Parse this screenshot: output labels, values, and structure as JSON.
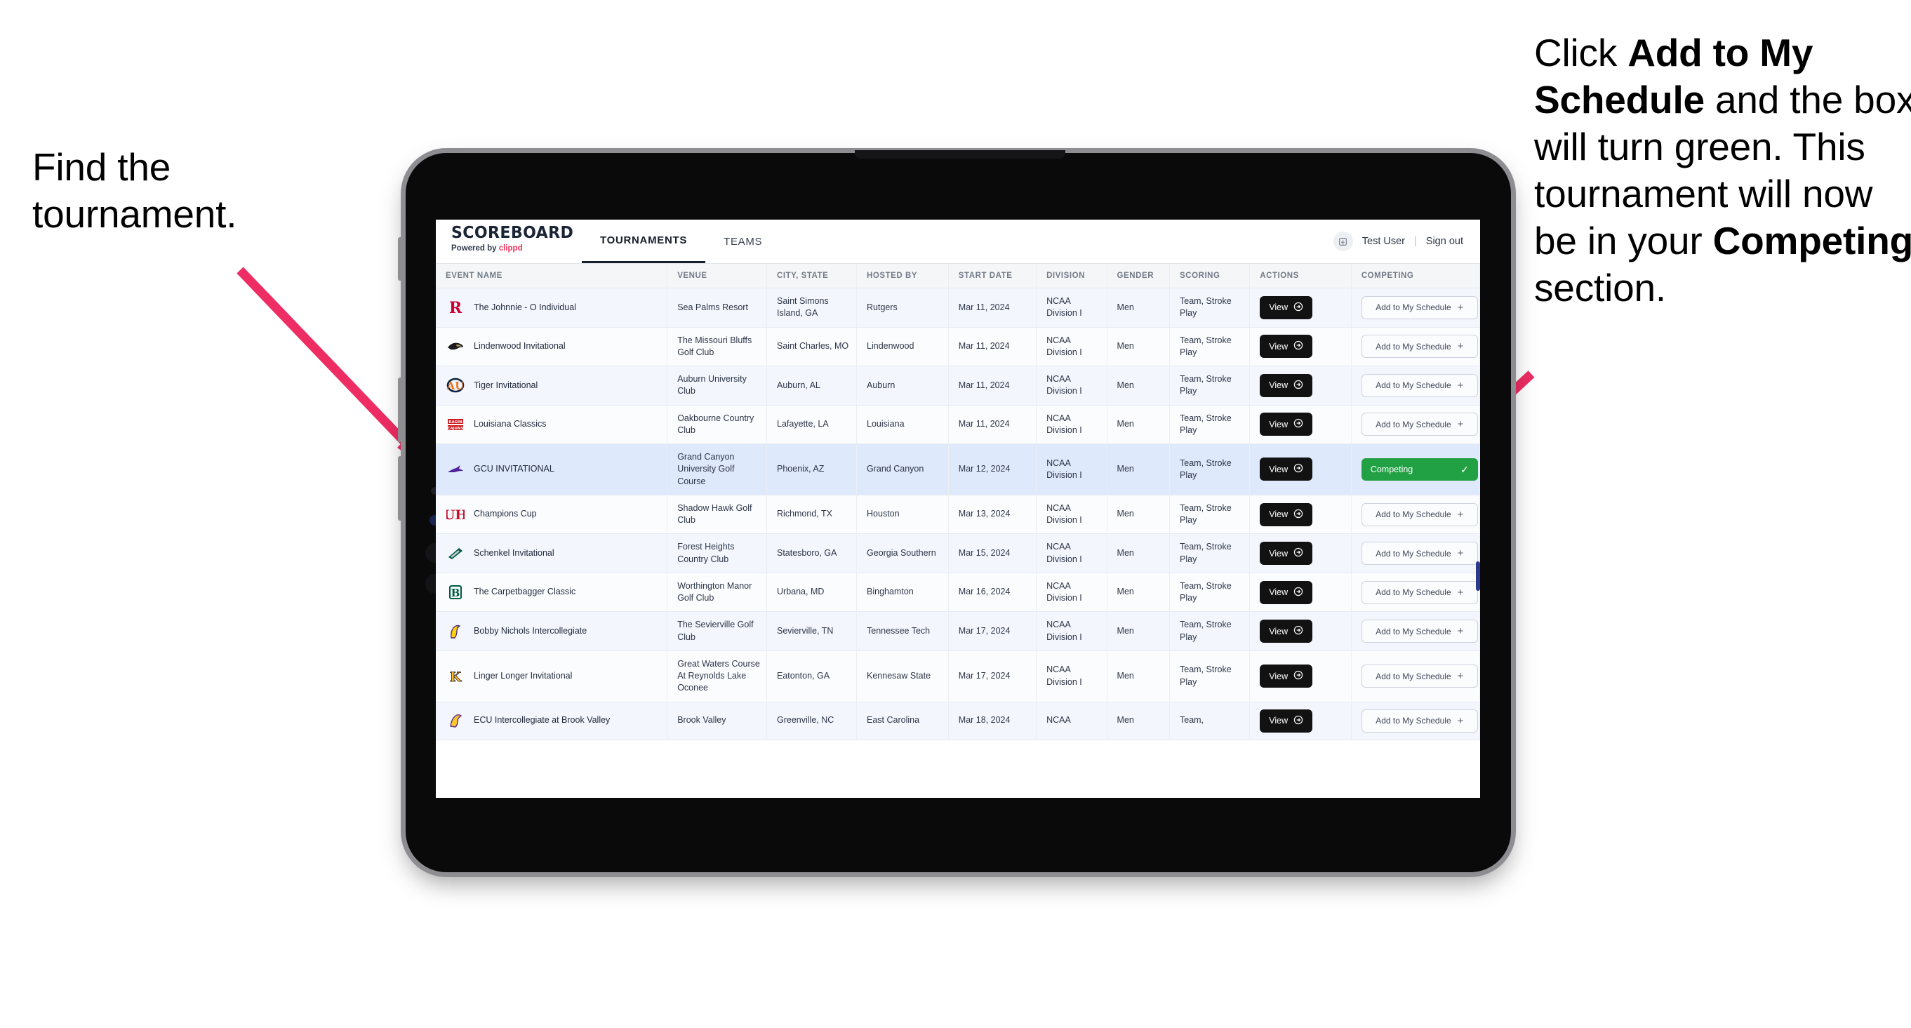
{
  "annotations": {
    "left": {
      "line1": "Find the",
      "line2": "tournament."
    },
    "right": {
      "seg1": "Click ",
      "bold1": "Add to My Schedule",
      "seg2": " and the box will turn green. This tournament will now be in your ",
      "bold2": "Competing",
      "seg3": " section."
    },
    "arrow_color": "#ED2D63"
  },
  "app": {
    "brand": {
      "title": "SCOREBOARD",
      "powered_prefix": "Powered by ",
      "powered_brand": "clippd"
    },
    "nav": [
      {
        "label": "TOURNAMENTS",
        "active": true
      },
      {
        "label": "TEAMS",
        "active": false
      }
    ],
    "account": {
      "avatar_icon": "user-avatar-icon",
      "user": "Test User",
      "separator": "|",
      "signout": "Sign out"
    },
    "table": {
      "columns": [
        "EVENT NAME",
        "VENUE",
        "CITY, STATE",
        "HOSTED BY",
        "START DATE",
        "DIVISION",
        "GENDER",
        "SCORING",
        "ACTIONS",
        "COMPETING"
      ],
      "view_label": "View",
      "add_label": "Add to My Schedule",
      "add_icon": "plus-icon",
      "competing_label": "Competing",
      "competing_icon": "check-icon",
      "view_icon": "arrow-circle-right-icon",
      "competing_color": "#22A144",
      "rows": [
        {
          "logo": "rutgers-logo",
          "event": "The Johnnie - O Individual",
          "venue": "Sea Palms Resort",
          "city": "Saint Simons Island, GA",
          "host": "Rutgers",
          "date": "Mar 11, 2024",
          "division": "NCAA Division I",
          "gender": "Men",
          "scoring": "Team, Stroke Play",
          "competing": false
        },
        {
          "logo": "lindenwood-logo",
          "event": "Lindenwood Invitational",
          "venue": "The Missouri Bluffs Golf Club",
          "city": "Saint Charles, MO",
          "host": "Lindenwood",
          "date": "Mar 11, 2024",
          "division": "NCAA Division I",
          "gender": "Men",
          "scoring": "Team, Stroke Play",
          "competing": false
        },
        {
          "logo": "auburn-logo",
          "event": "Tiger Invitational",
          "venue": "Auburn University Club",
          "city": "Auburn, AL",
          "host": "Auburn",
          "date": "Mar 11, 2024",
          "division": "NCAA Division I",
          "gender": "Men",
          "scoring": "Team, Stroke Play",
          "competing": false
        },
        {
          "logo": "louisiana-logo",
          "event": "Louisiana Classics",
          "venue": "Oakbourne Country Club",
          "city": "Lafayette, LA",
          "host": "Louisiana",
          "date": "Mar 11, 2024",
          "division": "NCAA Division I",
          "gender": "Men",
          "scoring": "Team, Stroke Play",
          "competing": false
        },
        {
          "logo": "gcu-logo",
          "event": "GCU INVITATIONAL",
          "venue": "Grand Canyon University Golf Course",
          "city": "Phoenix, AZ",
          "host": "Grand Canyon",
          "date": "Mar 12, 2024",
          "division": "NCAA Division I",
          "gender": "Men",
          "scoring": "Team, Stroke Play",
          "competing": true
        },
        {
          "logo": "houston-logo",
          "event": "Champions Cup",
          "venue": "Shadow Hawk Golf Club",
          "city": "Richmond, TX",
          "host": "Houston",
          "date": "Mar 13, 2024",
          "division": "NCAA Division I",
          "gender": "Men",
          "scoring": "Team, Stroke Play",
          "competing": false
        },
        {
          "logo": "georgia-southern-logo",
          "event": "Schenkel Invitational",
          "venue": "Forest Heights Country Club",
          "city": "Statesboro, GA",
          "host": "Georgia Southern",
          "date": "Mar 15, 2024",
          "division": "NCAA Division I",
          "gender": "Men",
          "scoring": "Team, Stroke Play",
          "competing": false
        },
        {
          "logo": "binghamton-logo",
          "event": "The Carpetbagger Classic",
          "venue": "Worthington Manor Golf Club",
          "city": "Urbana, MD",
          "host": "Binghamton",
          "date": "Mar 16, 2024",
          "division": "NCAA Division I",
          "gender": "Men",
          "scoring": "Team, Stroke Play",
          "competing": false
        },
        {
          "logo": "tennessee-tech-logo",
          "event": "Bobby Nichols Intercollegiate",
          "venue": "The Sevierville Golf Club",
          "city": "Sevierville, TN",
          "host": "Tennessee Tech",
          "date": "Mar 17, 2024",
          "division": "NCAA Division I",
          "gender": "Men",
          "scoring": "Team, Stroke Play",
          "competing": false
        },
        {
          "logo": "kennesaw-logo",
          "event": "Linger Longer Invitational",
          "venue": "Great Waters Course At Reynolds Lake Oconee",
          "city": "Eatonton, GA",
          "host": "Kennesaw State",
          "date": "Mar 17, 2024",
          "division": "NCAA Division I",
          "gender": "Men",
          "scoring": "Team, Stroke Play",
          "competing": false
        },
        {
          "logo": "east-carolina-logo",
          "event": "ECU Intercollegiate at Brook Valley",
          "venue": "Brook Valley",
          "city": "Greenville, NC",
          "host": "East Carolina",
          "date": "Mar 18, 2024",
          "division": "NCAA",
          "gender": "Men",
          "scoring": "Team,",
          "competing": false
        }
      ]
    }
  }
}
